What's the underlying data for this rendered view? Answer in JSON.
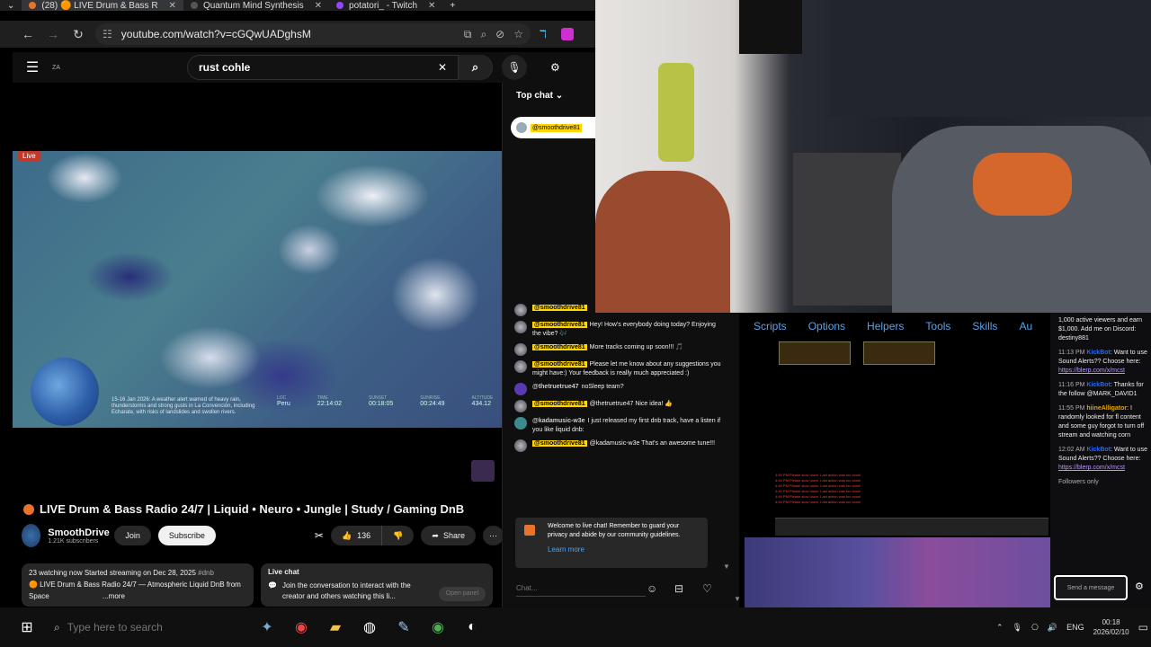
{
  "browser": {
    "tabs": [
      {
        "label": "(28) 🟠 LIVE Drum & Bass R",
        "active": true,
        "color": "#e8742c"
      },
      {
        "label": "Quantum Mind Synthesis",
        "active": false,
        "color": "#555"
      },
      {
        "label": "potatori_ - Twitch",
        "active": false,
        "color": "#9146ff"
      }
    ],
    "url": "youtube.com/watch?v=cGQwUADghsM"
  },
  "youtube": {
    "logo_text": "ZA",
    "search_value": "rust cohle",
    "live_badge": "Live",
    "video_overlay_text": "15-16 Jan 2026: A weather alert warned of heavy rain, thunderstorms and strong gusts in La Convención, including Echarate, with risks of landslides and swollen rivers.",
    "stats": [
      {
        "k": "LOC",
        "v": "Peru"
      },
      {
        "k": "TIME",
        "v": "22:14:02"
      },
      {
        "k": "SUNSET",
        "v": "00:18:05"
      },
      {
        "k": "SUNRISE",
        "v": "00:24:49"
      },
      {
        "k": "ALTITUDE",
        "v": "434.12"
      }
    ],
    "title": "LIVE Drum & Bass Radio 24/7 | Liquid • Neuro • Jungle | Study / Gaming DnB",
    "channel_name": "SmoothDrive",
    "subscribers": "1.21K subscribers",
    "join_label": "Join",
    "subscribe_label": "Subscribe",
    "like_count": "136",
    "share_label": "Share",
    "description_line1": "23 watching now  Started streaming on Dec 28, 2025",
    "description_hashtag": "#dnb",
    "description_line2": "🟠 LIVE Drum & Bass Radio 24/7 — Atmospheric Liquid DnB from Space",
    "description_more": "...more",
    "livechat_card_title": "Live chat",
    "livechat_card_text": "Join the conversation to interact with the creator and others watching this li...",
    "open_panel_label": "Open panel"
  },
  "ytchat": {
    "header": "Top chat",
    "pinned_user": "@smoothdrive81",
    "messages": [
      {
        "user": "@smoothdrive81",
        "tagged": true,
        "text": ""
      },
      {
        "user": "@smoothdrive81",
        "tagged": true,
        "text": "Hey! How's everybody doing today? Enjoying the vibe? 🎶"
      },
      {
        "user": "@smoothdrive81",
        "tagged": true,
        "text": "More tracks coming up soon!!! 🎵"
      },
      {
        "user": "@smoothdrive81",
        "tagged": true,
        "text": "Please let me know about any suggestions you might have:) Your feedback is really much appreciated :)"
      },
      {
        "user": "@thetruetrue47",
        "tagged": false,
        "text": "noSleep team?"
      },
      {
        "user": "@smoothdrive81",
        "tagged": true,
        "text": "@thetruetrue47 Nice idea! 👍"
      },
      {
        "user": "@kadamusic-w3e",
        "tagged": false,
        "text": "I just released my first dnb track, have a listen if you like liquid dnb:"
      },
      {
        "user": "@smoothdrive81",
        "tagged": true,
        "text": "@kadamusic-w3e That's an awesome tune!!!"
      }
    ],
    "welcome_text": "Welcome to live chat! Remember to guard your privacy and abide by our community guidelines.",
    "learn_more": "Learn more",
    "input_placeholder": "Chat..."
  },
  "game": {
    "tabs": [
      "Scripts",
      "Options",
      "Helpers",
      "Tools",
      "Skills",
      "Au"
    ],
    "log_lines": [
      "4:49 PM  Please slow down. Last action was too soon!",
      "4:49 PM  Please slow down. Last action was too soon!",
      "4:49 PM  Please slow down. Last action was too soon!",
      "4:49 PM  Please slow down. Last action was too soon!",
      "4:49 PM  Please slow down. Last action was too soon!",
      "4:49 PM  Please slow down. Last action was too soon!"
    ]
  },
  "twitch_chat": {
    "lines": [
      {
        "text": "1,000 active viewers and earn $1,000. Add me on Discord: destiny881"
      },
      {
        "time": "11:13 PM",
        "user": "KickBot",
        "text": "Want to use Sound Alerts?? Choose here:",
        "link": "https://blerp.com/x/mcst"
      },
      {
        "time": "11:16 PM",
        "user": "KickBot",
        "text": "Thanks for the follow @MARK_DAVID1"
      },
      {
        "time": "11:55 PM",
        "user": "hiineAlligator",
        "text": "I randomly looked for fl content and some guy forgot to turn off stream and watching corn"
      },
      {
        "time": "12:02 AM",
        "user": "KickBot",
        "text": "Want to use Sound Alerts?? Choose here:",
        "link": "https://blerp.com/x/mcst"
      }
    ],
    "followers_only": "Followers only",
    "send_placeholder": "Send a message"
  },
  "taskbar": {
    "search_placeholder": "Type here to search",
    "lang": "ENG",
    "time": "00:18",
    "date": "2026/02/10"
  }
}
